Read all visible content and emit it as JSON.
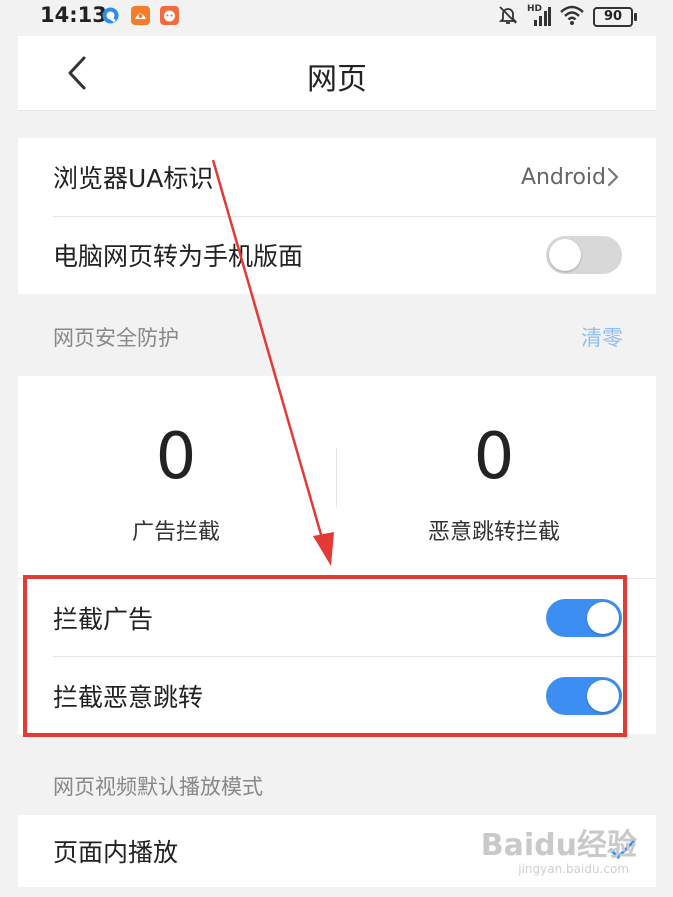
{
  "status_bar": {
    "time": "14:13",
    "network_badge": "HD",
    "battery": "90",
    "icons": [
      "app-q-icon",
      "app-orange-icon",
      "app-red-icon",
      "mute-bell-icon",
      "signal-icon",
      "wifi-icon",
      "battery-icon"
    ]
  },
  "header": {
    "title": "网页",
    "back_icon": "chevron-left-icon"
  },
  "settings": {
    "ua": {
      "label": "浏览器UA标识",
      "value": "Android"
    },
    "desktop_to_mobile": {
      "label": "电脑网页转为手机版面",
      "on": false
    }
  },
  "security": {
    "section_label": "网页安全防护",
    "clear_label": "清零",
    "ads_blocked": {
      "count": "0",
      "label": "广告拦截"
    },
    "redirects_blocked": {
      "count": "0",
      "label": "恶意跳转拦截"
    },
    "block_ads": {
      "label": "拦截广告",
      "on": true
    },
    "block_redirects": {
      "label": "拦截恶意跳转",
      "on": true
    }
  },
  "video": {
    "section_label": "网页视频默认播放模式",
    "inline_play": {
      "label": "页面内播放",
      "selected": true
    }
  },
  "watermark": {
    "brand": "Baidu经验",
    "url": "jingyan.baidu.com"
  },
  "colors": {
    "accent": "#3d8ef2",
    "annotation_red": "#e53935",
    "toggle_off": "#d8d8d8",
    "link": "#8fbef0",
    "background": "#f2f2f2"
  }
}
